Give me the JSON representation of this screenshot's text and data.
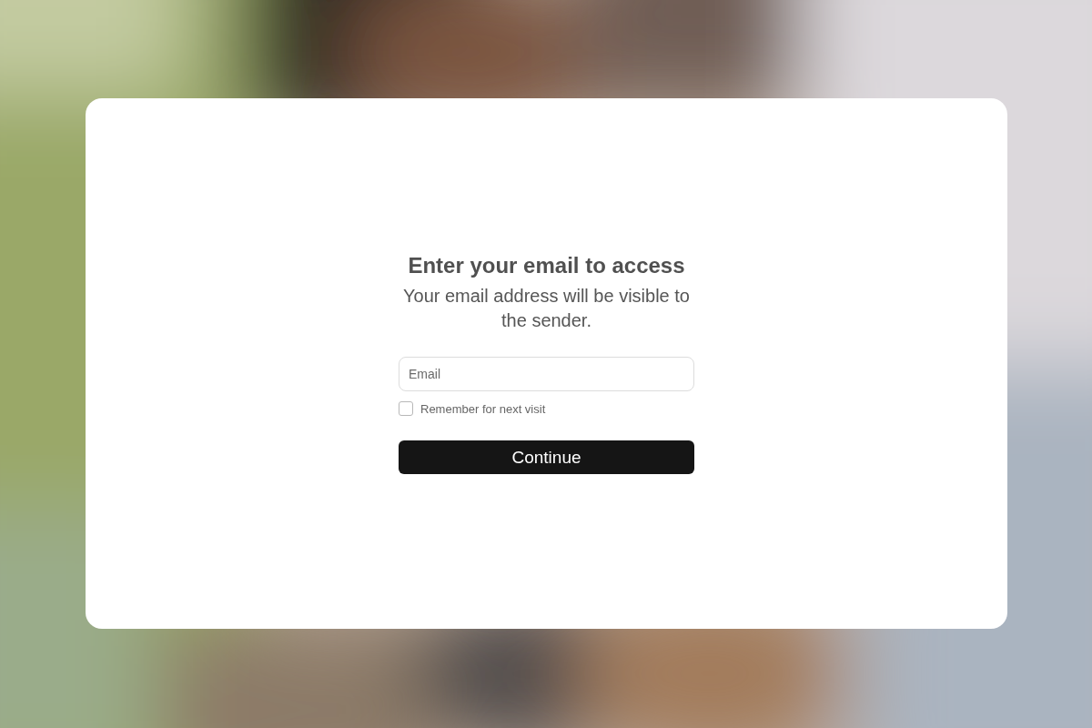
{
  "dialog": {
    "title": "Enter your email to access",
    "subtitle": "Your email address will be visible to the sender.",
    "email_field": {
      "placeholder": "Email"
    },
    "remember": {
      "label": "Remember for next visit",
      "checked": false
    },
    "button": "Continue"
  }
}
